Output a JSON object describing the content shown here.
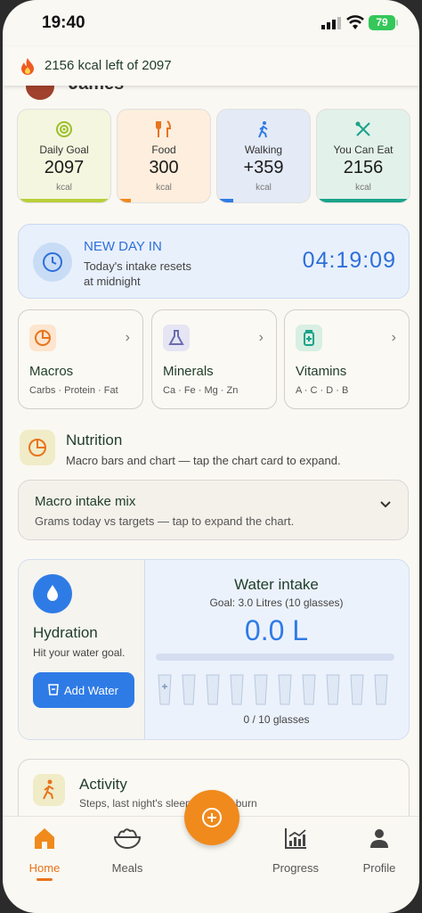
{
  "status": {
    "time": "19:40",
    "battery": "79"
  },
  "kcal_banner": {
    "text": "2156 kcal left of 2097"
  },
  "greeting": {
    "name": "James"
  },
  "stats": [
    {
      "label": "Daily Goal",
      "value": "2097",
      "unit": "kcal",
      "icon": "target-icon",
      "color": "#b9cf3a"
    },
    {
      "label": "Food",
      "value": "300",
      "unit": "kcal",
      "icon": "fork-knife-icon",
      "color": "#f08a1c"
    },
    {
      "label": "Walking",
      "value": "+359",
      "unit": "kcal",
      "icon": "walking-icon",
      "color": "#2f7be6"
    },
    {
      "label": "You Can Eat",
      "value": "2156",
      "unit": "kcal",
      "icon": "utensils-cross-icon",
      "color": "#1aa38a"
    }
  ],
  "new_day": {
    "title": "NEW DAY IN",
    "subtitle": "Today's intake resets at midnight",
    "countdown": "04:19:09"
  },
  "categories": [
    {
      "name": "Macros",
      "sub": "Carbs · Protein · Fat",
      "icon": "pie-icon"
    },
    {
      "name": "Minerals",
      "sub": "Ca · Fe · Mg · Zn",
      "icon": "flask-icon"
    },
    {
      "name": "Vitamins",
      "sub": "A · C · D · B",
      "icon": "pill-bottle-icon"
    }
  ],
  "nutrition": {
    "title": "Nutrition",
    "subtitle": "Macro bars and chart — tap the chart card to expand."
  },
  "macro_mix": {
    "title": "Macro intake mix",
    "subtitle": "Grams today vs targets — tap to expand the chart."
  },
  "hydration": {
    "title": "Hydration",
    "subtitle": "Hit your water goal.",
    "button": "Add Water",
    "water_title": "Water intake",
    "goal": "Goal: 3.0 Litres (10 glasses)",
    "value": "0.0 L",
    "glasses_text": "0 / 10 glasses",
    "progress": 0
  },
  "activity": {
    "title": "Activity",
    "subtitle": "Steps, last night's sleep, walking burn"
  },
  "nav": [
    {
      "label": "Home",
      "icon": "home-icon",
      "active": true
    },
    {
      "label": "Meals",
      "icon": "bowl-icon",
      "active": false
    },
    {
      "label": "Progress",
      "icon": "chart-icon",
      "active": false
    },
    {
      "label": "Profile",
      "icon": "profile-icon",
      "active": false
    }
  ]
}
